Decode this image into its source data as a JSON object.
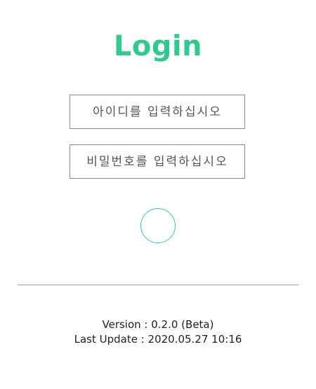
{
  "header": {
    "title": "Login"
  },
  "form": {
    "id_placeholder": "아이디를 입력하십시오",
    "password_placeholder": "비밀번호를 입력하십시오"
  },
  "footer": {
    "version": "Version : 0.2.0 (Beta)",
    "last_update": "Last Update : 2020.05.27  10:16"
  },
  "colors": {
    "accent": "#2ecc8c",
    "border": "#8a8a8a",
    "text": "#222222"
  }
}
